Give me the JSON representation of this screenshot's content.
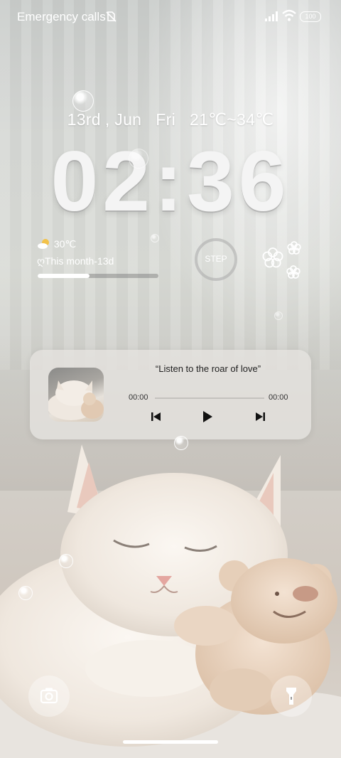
{
  "status_bar": {
    "carrier_text": "Emergency calls",
    "battery_level": "100",
    "icons": [
      "no-sim-icon",
      "signal-icon",
      "wifi-icon",
      "battery-icon"
    ]
  },
  "lock": {
    "date_day": "13rd",
    "date_month": ", Jun",
    "weekday": "Fri",
    "temp_range": "21℃~34℃",
    "time": "02:36"
  },
  "widgets": {
    "weather_temp": "30℃",
    "weather_icon": "partly-cloudy-icon",
    "month_label": "ღThis month-13d",
    "month_progress": 0.43,
    "step_label": "STEP",
    "flower_icon": "flower-icon"
  },
  "music": {
    "title": "“Listen to the roar of love”",
    "time_start": "00:00",
    "time_end": "00:00",
    "controls": [
      "previous-icon",
      "play-icon",
      "next-icon"
    ]
  },
  "shortcuts": [
    "camera-icon",
    "flashlight-icon"
  ],
  "colors": {
    "text": "#ffffff",
    "panel": "#e4e2de",
    "progress_track": "#787878"
  }
}
